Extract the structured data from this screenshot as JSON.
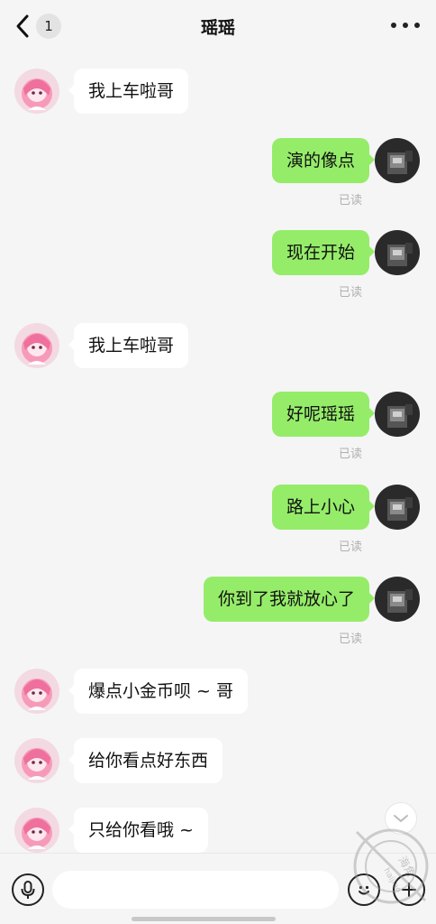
{
  "header": {
    "back_count": "1",
    "title": "瑶瑶"
  },
  "messages": [
    {
      "side": "in",
      "text": "我上车啦哥"
    },
    {
      "side": "out",
      "text": "演的像点",
      "status": "已读"
    },
    {
      "side": "out",
      "text": "现在开始",
      "status": "已读"
    },
    {
      "side": "in",
      "text": "我上车啦哥"
    },
    {
      "side": "out",
      "text": "好呢瑶瑶",
      "status": "已读"
    },
    {
      "side": "out",
      "text": "路上小心",
      "status": "已读"
    },
    {
      "side": "out",
      "text": "你到了我就放心了",
      "status": "已读"
    },
    {
      "side": "in",
      "text": "爆点小金币呗 ~ 哥"
    },
    {
      "side": "in",
      "text": "给你看点好东西"
    },
    {
      "side": "in",
      "text": "只给你看哦 ~"
    }
  ],
  "input": {
    "placeholder": ""
  },
  "watermark": {
    "text": "海角",
    "subtext": "haijiao"
  },
  "colors": {
    "outgoing_bubble": "#95ec69",
    "incoming_bubble": "#ffffff",
    "background": "#f5f5f5"
  },
  "icons": [
    "back-arrow-icon",
    "more-dots-icon",
    "voice-icon",
    "emoji-icon",
    "plus-icon",
    "chevron-down-icon"
  ]
}
